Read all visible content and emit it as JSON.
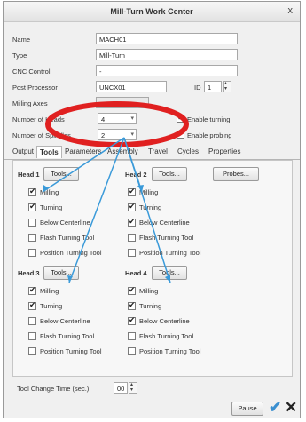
{
  "window": {
    "title": "Mill-Turn Work Center",
    "close_glyph": "x"
  },
  "form": {
    "name": {
      "label": "Name",
      "value": "MACH01"
    },
    "type": {
      "label": "Type",
      "value": "Mill-Turn"
    },
    "cnc_control": {
      "label": "CNC Control",
      "value": "-"
    },
    "post_processor": {
      "label": "Post Processor",
      "value": "UNCX01",
      "id_label": "ID",
      "id_value": "1"
    },
    "milling_axes": {
      "label": "Milling Axes"
    },
    "number_of_heads": {
      "label": "Number of Heads",
      "value": "4"
    },
    "number_of_spindles": {
      "label": "Number of Spindles",
      "value": "2"
    },
    "enable_turning": {
      "label": "Enable turning",
      "checked": true
    },
    "enable_probing": {
      "label": "Enable probing",
      "checked": true
    }
  },
  "tabs": [
    "Output",
    "Tools",
    "Parameters",
    "Assembly",
    "Travel",
    "Cycles",
    "Properties"
  ],
  "active_tab": "Tools",
  "heads": [
    {
      "label": "Head 1",
      "tools_button": "Tools...",
      "options": [
        {
          "label": "Milling",
          "checked": true
        },
        {
          "label": "Turning",
          "checked": true
        },
        {
          "label": "Below Centerline",
          "checked": false
        },
        {
          "label": "Flash Turning Tool",
          "checked": false
        },
        {
          "label": "Position Turning Tool",
          "checked": false
        }
      ]
    },
    {
      "label": "Head 2",
      "tools_button": "Tools...",
      "options": [
        {
          "label": "Milling",
          "checked": true
        },
        {
          "label": "Turning",
          "checked": true
        },
        {
          "label": "Below Centerline",
          "checked": true
        },
        {
          "label": "Flash Turning Tool",
          "checked": false
        },
        {
          "label": "Position Turning Tool",
          "checked": false
        }
      ]
    },
    {
      "label": "Head 3",
      "tools_button": "Tools...",
      "options": [
        {
          "label": "Milling",
          "checked": true
        },
        {
          "label": "Turning",
          "checked": true
        },
        {
          "label": "Below Centerline",
          "checked": false
        },
        {
          "label": "Flash Turning Tool",
          "checked": false
        },
        {
          "label": "Position Turning Tool",
          "checked": false
        }
      ]
    },
    {
      "label": "Head 4",
      "tools_button": "Tools...",
      "options": [
        {
          "label": "Milling",
          "checked": true
        },
        {
          "label": "Turning",
          "checked": true
        },
        {
          "label": "Below Centerline",
          "checked": true
        },
        {
          "label": "Flash Turning Tool",
          "checked": false
        },
        {
          "label": "Position Turning Tool",
          "checked": false
        }
      ]
    }
  ],
  "probes_button": "Probes...",
  "tool_change_time": {
    "label": "Tool Change Time (sec.)",
    "value": "00"
  },
  "footer": {
    "pause_button": "Pause",
    "ok_icon": "checkmark-icon",
    "cancel_icon": "close-icon"
  },
  "colors": {
    "annotation_red": "#e02020",
    "annotation_blue": "#3a9ad9"
  }
}
